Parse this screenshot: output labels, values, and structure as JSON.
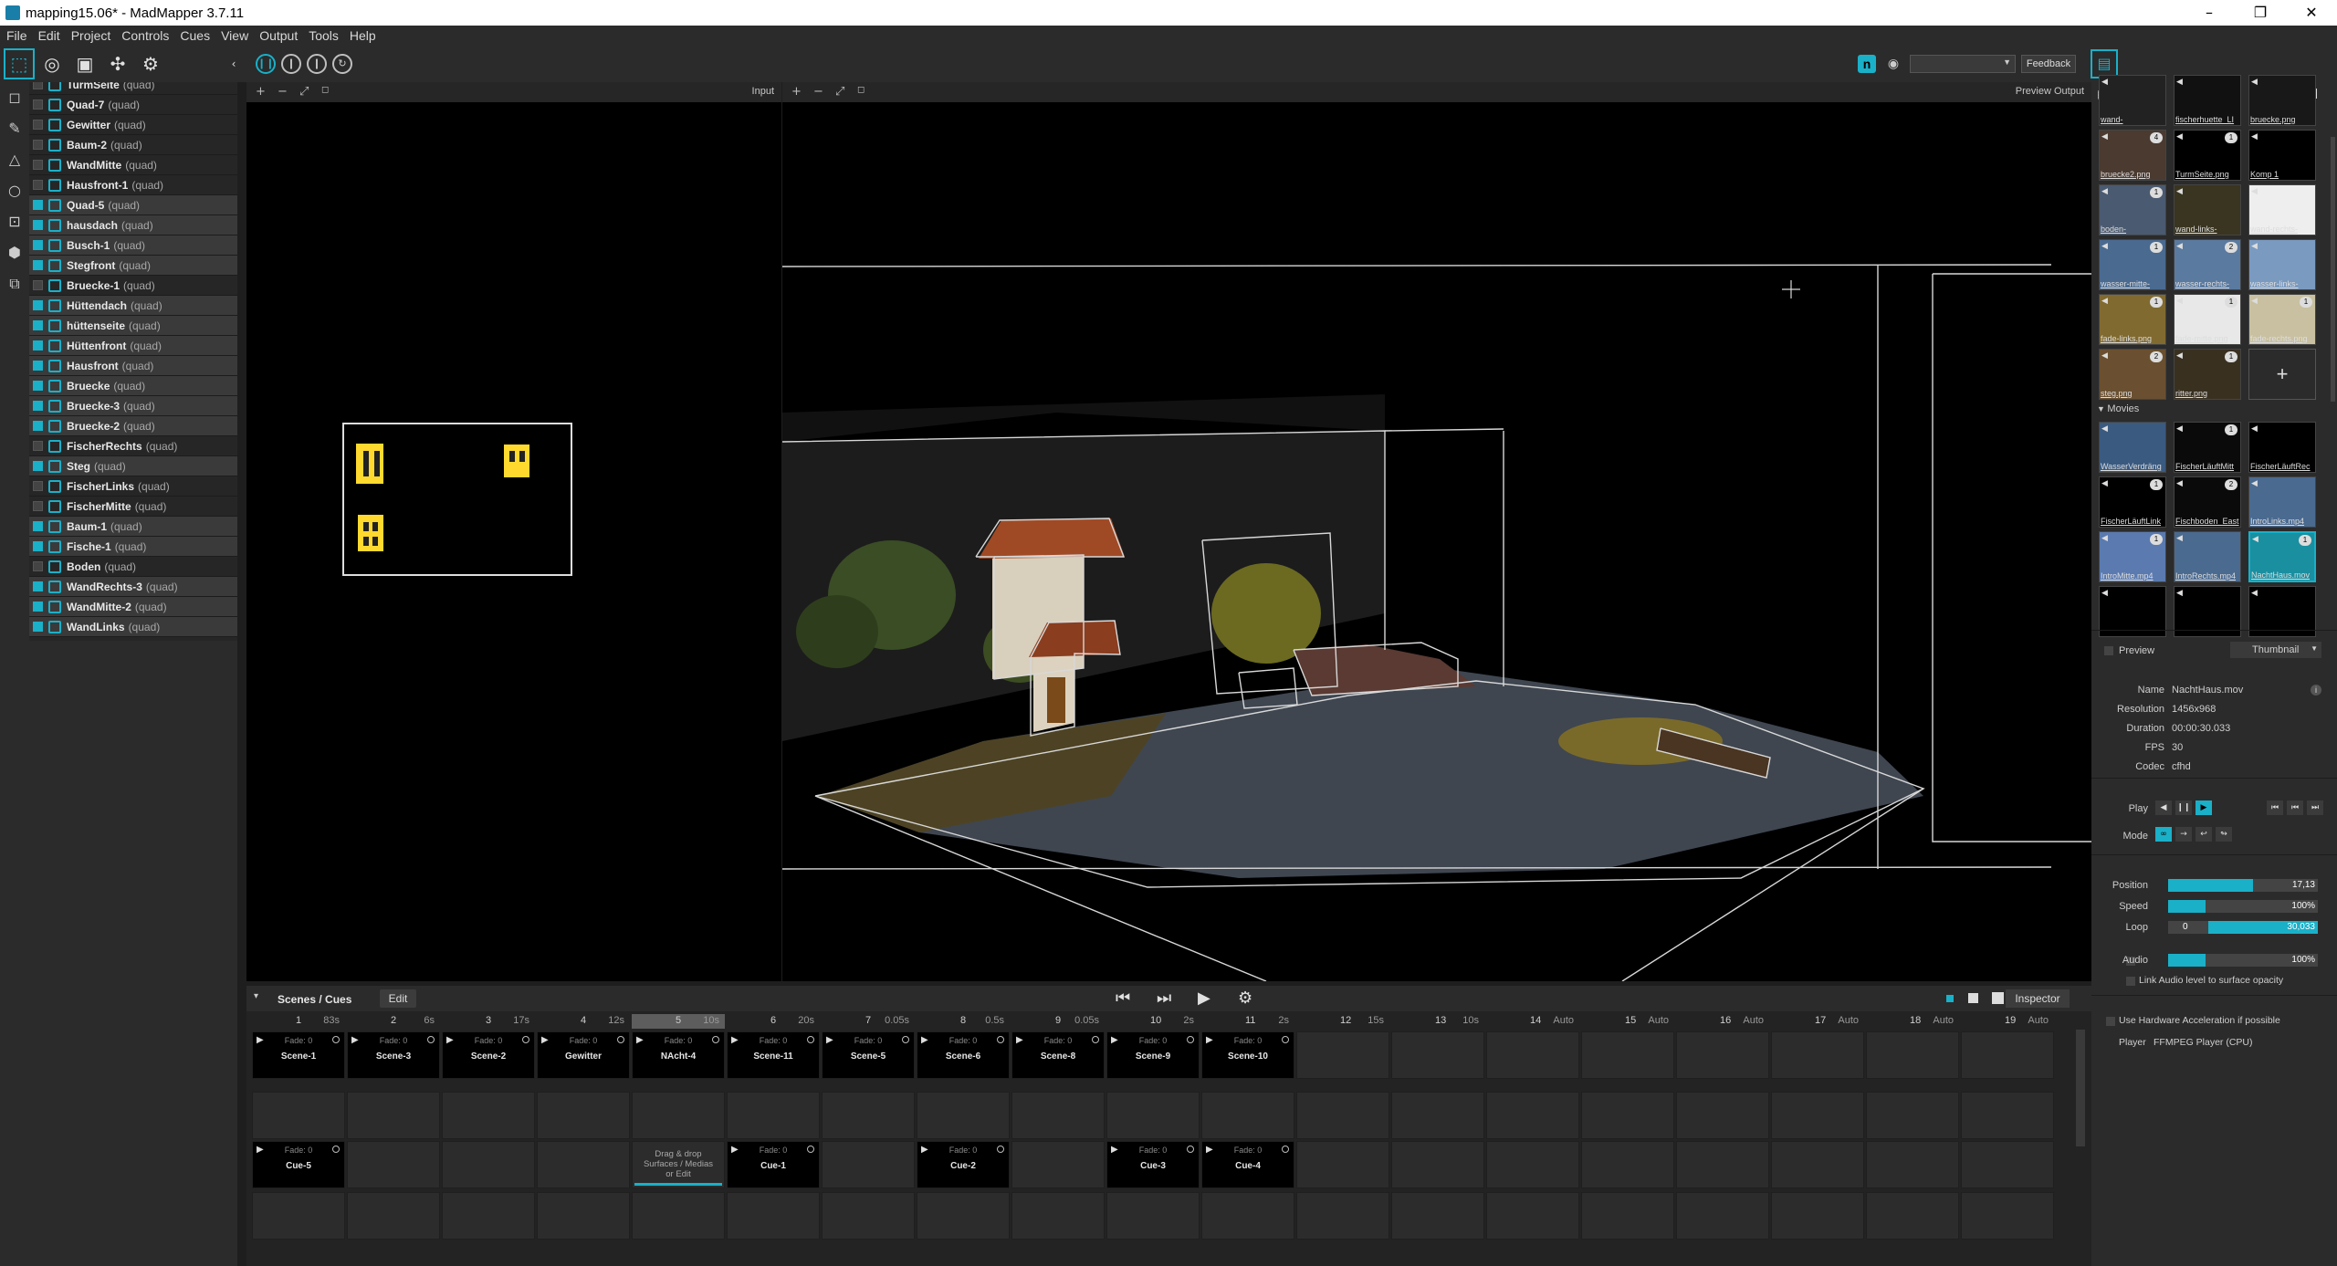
{
  "window": {
    "title": "mapping15.06* - MadMapper 3.7.11",
    "minimize": "–",
    "maximize": "❐",
    "close": "✕"
  },
  "menu": [
    "File",
    "Edit",
    "Project",
    "Controls",
    "Cues",
    "View",
    "Output",
    "Tools",
    "Help"
  ],
  "toolbar": {
    "feedback_label": "Feedback",
    "output_select": ""
  },
  "surfaces": [
    {
      "name": "TurmSeite",
      "type": "(quad)",
      "checked": false,
      "hl": false
    },
    {
      "name": "Quad-7",
      "type": "(quad)",
      "checked": false,
      "hl": false
    },
    {
      "name": "Gewitter",
      "type": "(quad)",
      "checked": false,
      "hl": false
    },
    {
      "name": "Baum-2",
      "type": "(quad)",
      "checked": false,
      "hl": false
    },
    {
      "name": "WandMitte",
      "type": "(quad)",
      "checked": false,
      "hl": false
    },
    {
      "name": "Hausfront-1",
      "type": "(quad)",
      "checked": false,
      "hl": false
    },
    {
      "name": "Quad-5",
      "type": "(quad)",
      "checked": true,
      "hl": true
    },
    {
      "name": "hausdach",
      "type": "(quad)",
      "checked": true,
      "hl": true
    },
    {
      "name": "Busch-1",
      "type": "(quad)",
      "checked": true,
      "hl": true
    },
    {
      "name": "Stegfront",
      "type": "(quad)",
      "checked": true,
      "hl": true
    },
    {
      "name": "Bruecke-1",
      "type": "(quad)",
      "checked": false,
      "hl": false
    },
    {
      "name": "Hüttendach",
      "type": "(quad)",
      "checked": true,
      "hl": true
    },
    {
      "name": "hüttenseite",
      "type": "(quad)",
      "checked": true,
      "hl": true
    },
    {
      "name": "Hüttenfront",
      "type": "(quad)",
      "checked": true,
      "hl": true
    },
    {
      "name": "Hausfront",
      "type": "(quad)",
      "checked": true,
      "hl": true
    },
    {
      "name": "Bruecke",
      "type": "(quad)",
      "checked": true,
      "hl": true
    },
    {
      "name": "Bruecke-3",
      "type": "(quad)",
      "checked": true,
      "hl": true
    },
    {
      "name": "Bruecke-2",
      "type": "(quad)",
      "checked": true,
      "hl": true
    },
    {
      "name": "FischerRechts",
      "type": "(quad)",
      "checked": false,
      "hl": false
    },
    {
      "name": "Steg",
      "type": "(quad)",
      "checked": true,
      "hl": true
    },
    {
      "name": "FischerLinks",
      "type": "(quad)",
      "checked": false,
      "hl": false
    },
    {
      "name": "FischerMitte",
      "type": "(quad)",
      "checked": false,
      "hl": false
    },
    {
      "name": "Baum-1",
      "type": "(quad)",
      "checked": true,
      "hl": true
    },
    {
      "name": "Fische-1",
      "type": "(quad)",
      "checked": true,
      "hl": true
    },
    {
      "name": "Boden",
      "type": "(quad)",
      "checked": false,
      "hl": false
    },
    {
      "name": "WandRechts-3",
      "type": "(quad)",
      "checked": true,
      "hl": true
    },
    {
      "name": "WandMitte-2",
      "type": "(quad)",
      "checked": true,
      "hl": true
    },
    {
      "name": "WandLinks",
      "type": "(quad)",
      "checked": true,
      "hl": true
    }
  ],
  "views": {
    "input_label": "Input",
    "output_label": "Preview Output"
  },
  "cues": {
    "title": "Scenes / Cues",
    "edit_label": "Edit",
    "inspector_label": "Inspector",
    "columns": [
      {
        "num": "1",
        "time": "83s"
      },
      {
        "num": "2",
        "time": "6s"
      },
      {
        "num": "3",
        "time": "17s"
      },
      {
        "num": "4",
        "time": "12s"
      },
      {
        "num": "5",
        "time": "10s"
      },
      {
        "num": "6",
        "time": "20s"
      },
      {
        "num": "7",
        "time": "0.05s"
      },
      {
        "num": "8",
        "time": "0.5s"
      },
      {
        "num": "9",
        "time": "0.05s"
      },
      {
        "num": "10",
        "time": "2s"
      },
      {
        "num": "11",
        "time": "2s"
      },
      {
        "num": "12",
        "time": "15s"
      },
      {
        "num": "13",
        "time": "10s"
      },
      {
        "num": "14",
        "time": "Auto"
      },
      {
        "num": "15",
        "time": "Auto"
      },
      {
        "num": "16",
        "time": "Auto"
      },
      {
        "num": "17",
        "time": "Auto"
      },
      {
        "num": "18",
        "time": "Auto"
      },
      {
        "num": "19",
        "time": "Auto"
      }
    ],
    "selected_column": 4,
    "row1": [
      "Scene-1",
      "Scene-3",
      "Scene-2",
      "Gewitter",
      "NAcht-4",
      "Scene-11",
      "Scene-5",
      "Scene-6",
      "Scene-8",
      "Scene-9",
      "Scene-10"
    ],
    "row3": [
      {
        "col": 0,
        "name": "Cue-5"
      },
      {
        "col": 5,
        "name": "Cue-1"
      },
      {
        "col": 7,
        "name": "Cue-2"
      },
      {
        "col": 9,
        "name": "Cue-3"
      },
      {
        "col": 10,
        "name": "Cue-4"
      }
    ],
    "fade_label": "Fade: 0",
    "drop_text": [
      "Drag & drop",
      "Surfaces / Medias",
      "or Edit"
    ]
  },
  "media": {
    "images": [
      {
        "label": "wand-",
        "badge": ""
      },
      {
        "label": "fischerhuette_LI",
        "badge": ""
      },
      {
        "label": "bruecke.png",
        "badge": ""
      },
      {
        "label": "bruecke2.png",
        "badge": "4"
      },
      {
        "label": "TurmSeite.png",
        "badge": "1"
      },
      {
        "label": "Komp 1",
        "badge": ""
      },
      {
        "label": "boden-",
        "badge": "1"
      },
      {
        "label": "wand-links-",
        "badge": ""
      },
      {
        "label": "wand-rechts-",
        "badge": ""
      },
      {
        "label": "wasser-mitte-",
        "badge": "1"
      },
      {
        "label": "wasser-rechts-",
        "badge": "2"
      },
      {
        "label": "wasser-links-",
        "badge": ""
      },
      {
        "label": "fade-links.png",
        "badge": "1"
      },
      {
        "label": "fade-mitte.png",
        "badge": "1"
      },
      {
        "label": "fade-rechts.png",
        "badge": "1"
      },
      {
        "label": "steg.png",
        "badge": "2"
      },
      {
        "label": "ritter.png",
        "badge": "1"
      }
    ],
    "add_label": "+",
    "movies_label": "Movies",
    "movies": [
      {
        "label": "WasserVerdräng",
        "badge": ""
      },
      {
        "label": "FischerLäuftMitt",
        "badge": "1"
      },
      {
        "label": "FischerLäuftRec",
        "badge": ""
      },
      {
        "label": "FischerLäuftLink",
        "badge": "1"
      },
      {
        "label": "Fischboden_East",
        "badge": "2"
      },
      {
        "label": "IntroLinks.mp4",
        "badge": ""
      },
      {
        "label": "IntroMitte.mp4",
        "badge": "1"
      },
      {
        "label": "IntroRechts.mp4",
        "badge": ""
      },
      {
        "label": "NachtHaus.mov",
        "badge": "1"
      },
      {
        "label": "",
        "badge": ""
      },
      {
        "label": "",
        "badge": ""
      },
      {
        "label": "",
        "badge": ""
      }
    ]
  },
  "inspector": {
    "preview_label": "Preview",
    "thumbnail_select": "Thumbnail",
    "props": [
      {
        "key": "Name",
        "value": "NachtHaus.mov"
      },
      {
        "key": "Resolution",
        "value": "1456x968"
      },
      {
        "key": "Duration",
        "value": "00:00:30.033"
      },
      {
        "key": "FPS",
        "value": "30"
      },
      {
        "key": "Codec",
        "value": "cfhd"
      }
    ],
    "play_label": "Play",
    "mode_label": "Mode",
    "position": {
      "label": "Position",
      "value": "17,13",
      "fraction": 0.57
    },
    "speed": {
      "label": "Speed",
      "value": "100%",
      "fraction": 0.25
    },
    "loop": {
      "label": "Loop",
      "start": "0",
      "end": "30,033",
      "fraction": 0.0
    },
    "audio": {
      "label": "Audio",
      "value": "100%",
      "fraction": 0.25
    },
    "link_audio_label": "Link Audio level to surface opacity",
    "hw_accel_label": "Use Hardware Acceleration if possible",
    "player_label": "Player",
    "player_value": "FFMPEG Player (CPU)"
  },
  "colors": {
    "accent": "#1ab0c8",
    "window_yellow": "#ffd92e"
  }
}
